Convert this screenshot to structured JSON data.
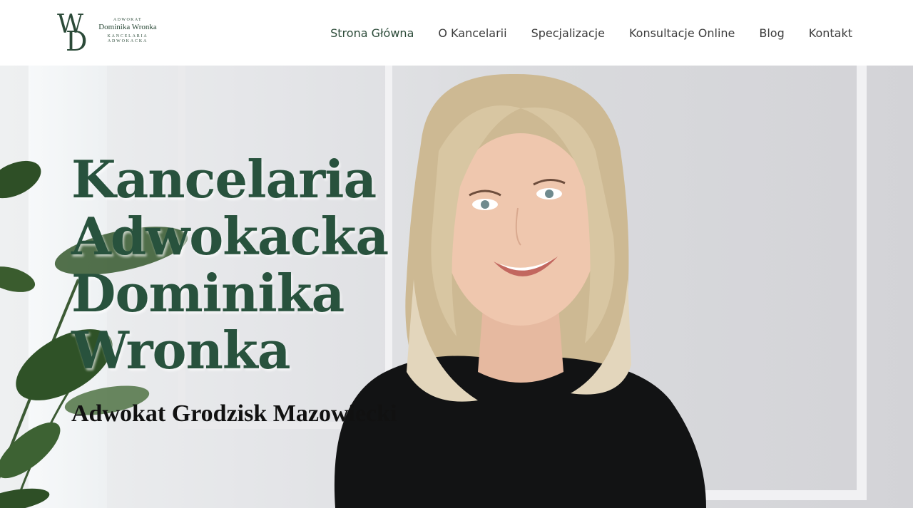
{
  "logo": {
    "line1": "ADWOKAT",
    "line2": "Dominika Wronka",
    "line3": "KANCELARIA",
    "line4": "ADWOKACKA"
  },
  "nav": {
    "items": [
      {
        "label": "Strona Główna",
        "active": true
      },
      {
        "label": "O Kancelarii"
      },
      {
        "label": "Specjalizacje"
      },
      {
        "label": "Konsultacje Online"
      },
      {
        "label": "Blog"
      },
      {
        "label": "Kontakt"
      }
    ]
  },
  "hero": {
    "title_lines": [
      "Kancelaria",
      "Adwokacka",
      "Dominika",
      "Wronka"
    ],
    "subtitle": "Adwokat Grodzisk Mazowiecki"
  },
  "colors": {
    "brand_green": "#28523d",
    "nav_text": "#3c3c3c",
    "header_bg": "#ffffff"
  }
}
